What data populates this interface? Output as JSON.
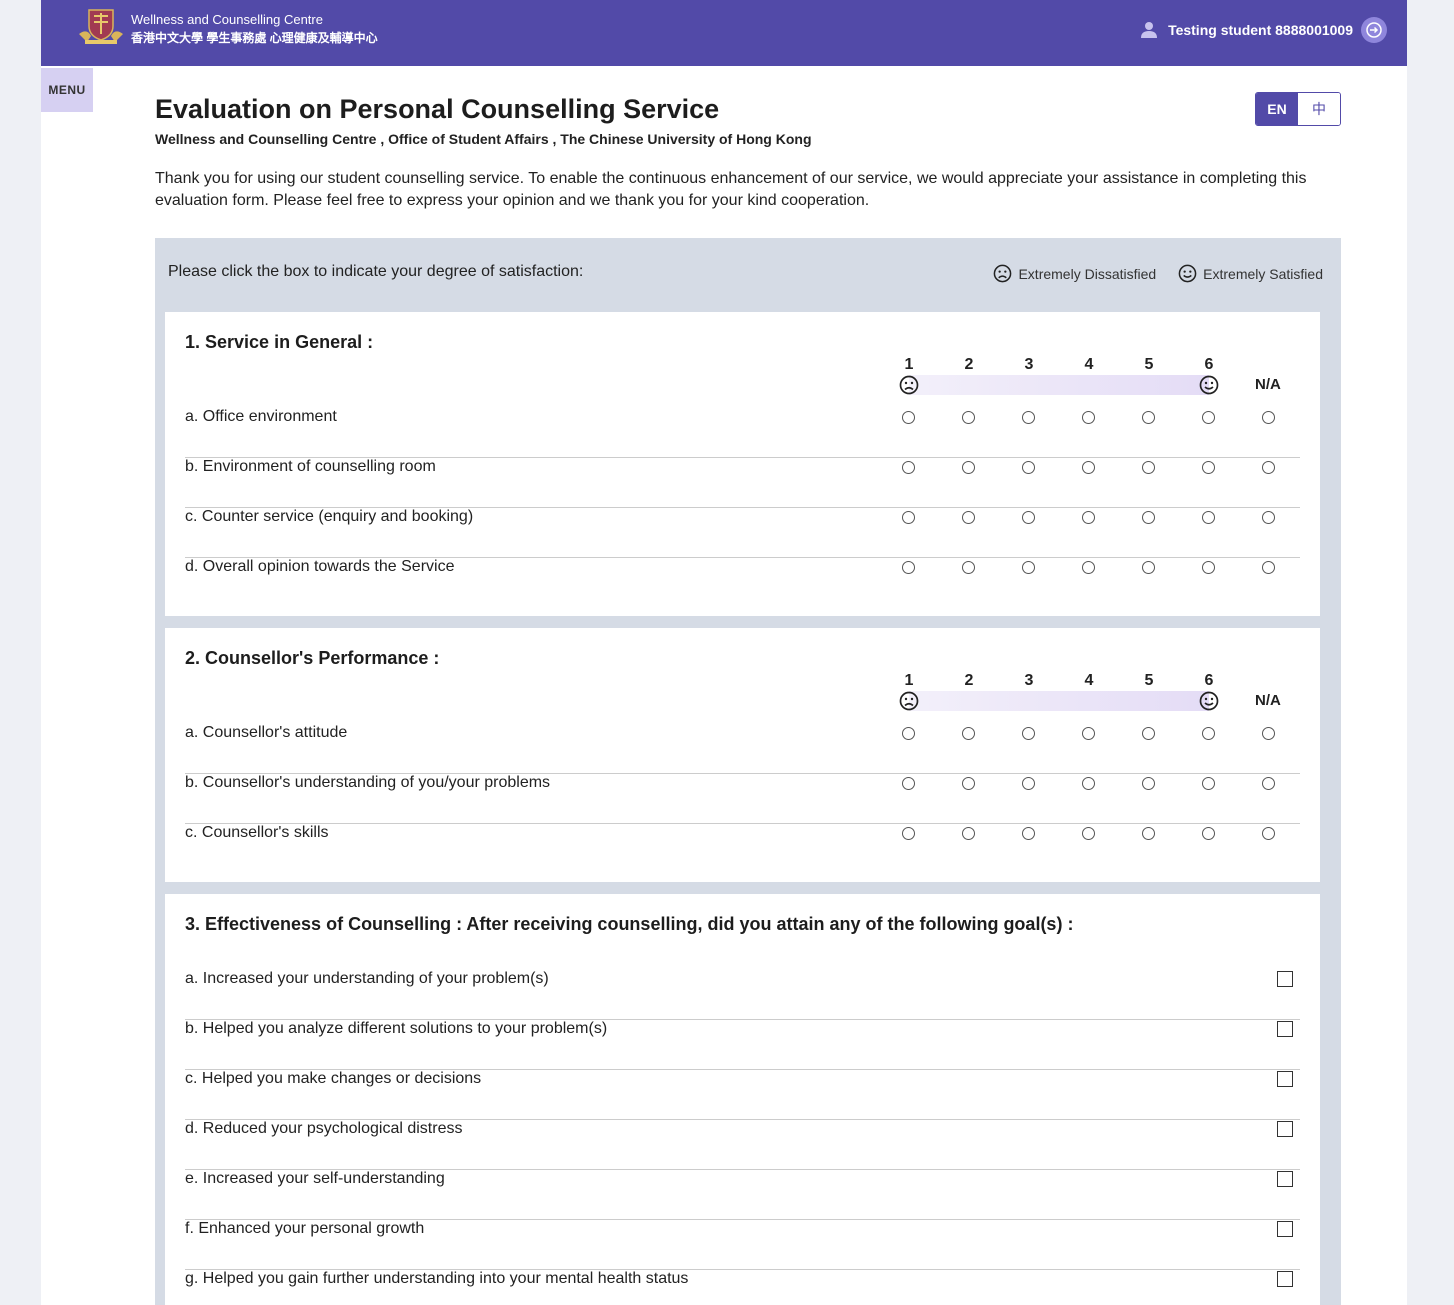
{
  "header": {
    "brand_en": "Wellness and Counselling Centre",
    "brand_zh": "香港中文大學 學生事務處 心理健康及輔導中心",
    "user": "Testing student 8888001009"
  },
  "menu_label": "MENU",
  "page": {
    "title": "Evaluation on Personal Counselling Service",
    "subtitle": "Wellness and Counselling Centre , Office of Student Affairs , The Chinese University of Hong Kong",
    "intro": "Thank you for using our student counselling service. To enable the continuous enhancement of our service, we would appreciate your assistance in completing this evaluation form. Please feel free to express your opinion and we thank you for your kind cooperation."
  },
  "lang": {
    "en": "EN",
    "zh": "中"
  },
  "instructions": "Please click the box to indicate your degree of satisfaction:",
  "legend": {
    "dissatisfied": "Extremely Dissatisfied",
    "satisfied": "Extremely Satisfied"
  },
  "scale": {
    "labels": [
      "1",
      "2",
      "3",
      "4",
      "5",
      "6"
    ],
    "na": "N/A"
  },
  "section1": {
    "title": "1. Service in General :",
    "items": [
      "a. Office environment",
      "b. Environment of counselling room",
      "c. Counter service (enquiry and booking)",
      "d. Overall opinion towards the Service"
    ]
  },
  "section2": {
    "title": "2. Counsellor's Performance :",
    "items": [
      "a. Counsellor's attitude",
      "b. Counsellor's understanding of you/your problems",
      "c. Counsellor's skills"
    ]
  },
  "section3": {
    "title": "3. Effectiveness of Counselling : After receiving counselling, did you attain any of the following goal(s) :",
    "items": [
      "a. Increased your understanding of your problem(s)",
      "b. Helped you analyze different solutions to your problem(s)",
      "c. Helped you make changes or decisions",
      "d. Reduced your psychological distress",
      "e. Increased your self-understanding",
      "f. Enhanced your personal growth",
      "g. Helped you gain further understanding into your mental health status"
    ]
  }
}
